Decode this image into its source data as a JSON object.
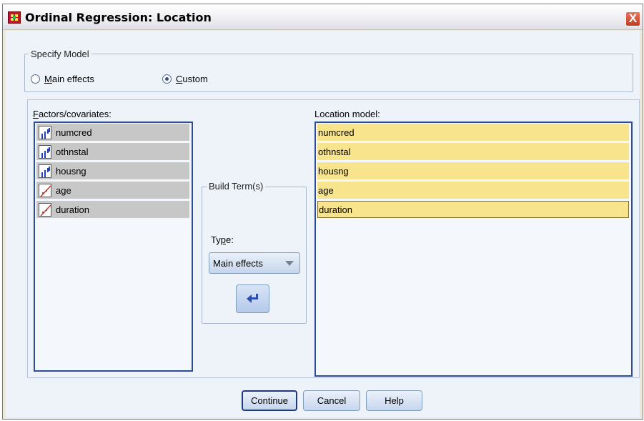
{
  "window": {
    "title": "Ordinal Regression: Location",
    "close_symbol": "X"
  },
  "specify_model": {
    "legend": "Specify Model",
    "options": [
      {
        "label_first": "M",
        "label_rest": "ain effects",
        "selected": false
      },
      {
        "label_first": "C",
        "label_rest": "ustom",
        "selected": true
      }
    ]
  },
  "factors": {
    "label_first": "F",
    "label_rest": "actors/covariates:",
    "items": [
      {
        "label": "numcred",
        "icon": "ordinal-icon"
      },
      {
        "label": "othnstal",
        "icon": "ordinal-icon"
      },
      {
        "label": "housng",
        "icon": "ordinal-icon"
      },
      {
        "label": "age",
        "icon": "scale-icon"
      },
      {
        "label": "duration",
        "icon": "scale-icon"
      }
    ]
  },
  "build_terms": {
    "legend": "Build Term(s)",
    "type_label_first": "Ty",
    "type_label_u": "p",
    "type_label_rest": "e:",
    "type_value": "Main effects"
  },
  "location_model": {
    "label": "Location model:",
    "items": [
      "numcred",
      "othnstal",
      "housng",
      "age",
      "duration"
    ]
  },
  "buttons": {
    "continue": "Continue",
    "cancel": "Cancel",
    "help": "Help"
  },
  "colors": {
    "selection_location": "#f8e48c",
    "selection_factors": "#c7c7c7",
    "listbox_border": "#2d4c9a",
    "arrow": "#2b4cb0"
  }
}
